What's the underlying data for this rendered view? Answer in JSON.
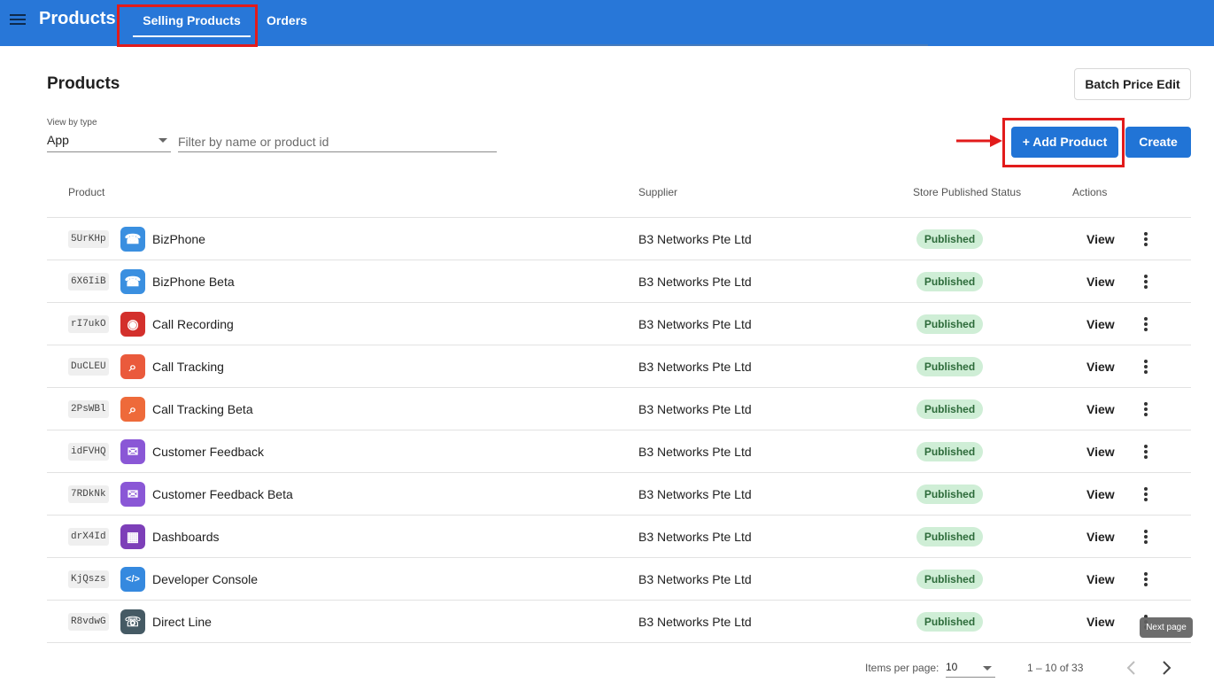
{
  "app": {
    "title": "Products",
    "tabs": [
      {
        "label": "Selling Products",
        "active": true
      },
      {
        "label": "Orders",
        "active": false
      }
    ]
  },
  "header": {
    "title": "Products",
    "batch_button": "Batch Price Edit"
  },
  "filters": {
    "view_label": "View by type",
    "view_value": "App",
    "search_placeholder": "Filter by name or product id"
  },
  "actions": {
    "add_product": "+ Add Product",
    "create": "Create"
  },
  "table": {
    "columns": [
      "Product",
      "Supplier",
      "Store Published Status",
      "Actions"
    ],
    "rows": [
      {
        "id": "5UrKHp",
        "name": "BizPhone",
        "supplier": "B3 Networks Pte Ltd",
        "status": "Published",
        "action": "View",
        "icon": "phone-icon",
        "color": "#3a8fe0"
      },
      {
        "id": "6X6IiB",
        "name": "BizPhone Beta",
        "supplier": "B3 Networks Pte Ltd",
        "status": "Published",
        "action": "View",
        "icon": "phone-icon",
        "color": "#3a8fe0"
      },
      {
        "id": "rI7ukO",
        "name": "Call Recording",
        "supplier": "B3 Networks Pte Ltd",
        "status": "Published",
        "action": "View",
        "icon": "recording-icon",
        "color": "#d3302c"
      },
      {
        "id": "DuCLEU",
        "name": "Call Tracking",
        "supplier": "B3 Networks Pte Ltd",
        "status": "Published",
        "action": "View",
        "icon": "tracking-icon",
        "color": "#ea5a3c"
      },
      {
        "id": "2PsWBl",
        "name": "Call Tracking Beta",
        "supplier": "B3 Networks Pte Ltd",
        "status": "Published",
        "action": "View",
        "icon": "tracking-icon",
        "color": "#ee6a3a"
      },
      {
        "id": "idFVHQ",
        "name": "Customer Feedback",
        "supplier": "B3 Networks Pte Ltd",
        "status": "Published",
        "action": "View",
        "icon": "feedback-icon",
        "color": "#8a57d6"
      },
      {
        "id": "7RDkNk",
        "name": "Customer Feedback Beta",
        "supplier": "B3 Networks Pte Ltd",
        "status": "Published",
        "action": "View",
        "icon": "feedback-icon",
        "color": "#8a57d6"
      },
      {
        "id": "drX4Id",
        "name": "Dashboards",
        "supplier": "B3 Networks Pte Ltd",
        "status": "Published",
        "action": "View",
        "icon": "dashboard-icon",
        "color": "#7d3fb8"
      },
      {
        "id": "KjQszs",
        "name": "Developer Console",
        "supplier": "B3 Networks Pte Ltd",
        "status": "Published",
        "action": "View",
        "icon": "code-icon",
        "color": "#3589df"
      },
      {
        "id": "R8vdwG",
        "name": "Direct Line",
        "supplier": "B3 Networks Pte Ltd",
        "status": "Published",
        "action": "View",
        "icon": "direct-line-icon",
        "color": "#455a64"
      }
    ]
  },
  "tooltip": "Next page",
  "pagination": {
    "items_label": "Items per page:",
    "items_value": "10",
    "range": "1 – 10 of 33"
  }
}
